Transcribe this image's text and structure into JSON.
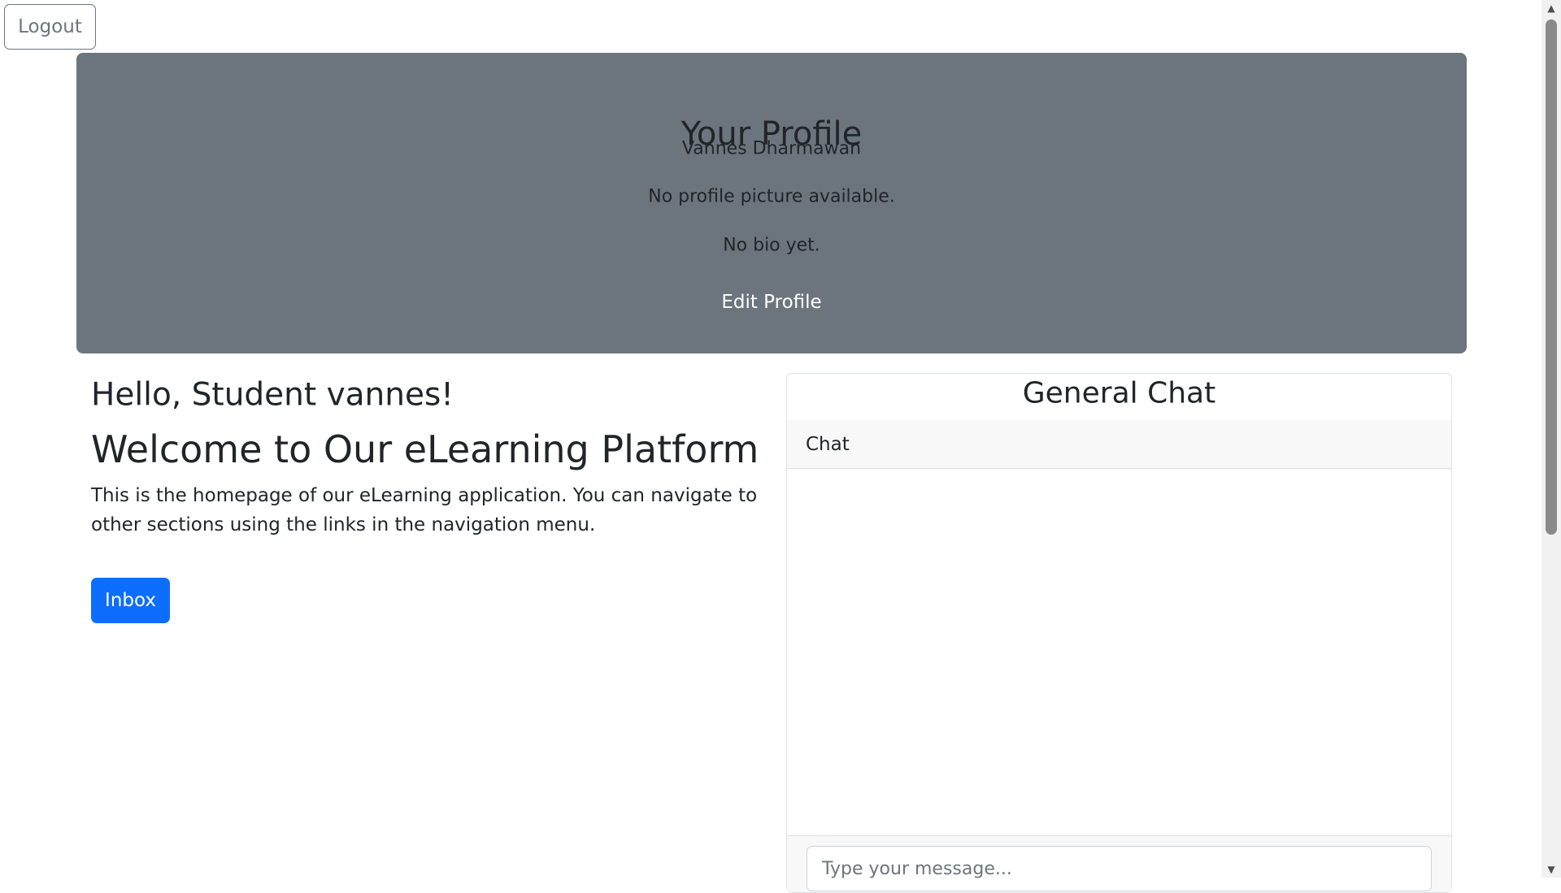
{
  "logout_label": "Logout",
  "profile": {
    "title": "Your Profile",
    "name": "Vannes Dharmawan",
    "picture_text": "No profile picture available.",
    "bio": "No bio yet.",
    "edit_label": "Edit Profile",
    "background_color": "#6c757d"
  },
  "main": {
    "greeting": "Hello, Student vannes!",
    "welcome_heading": "Welcome to Our eLearning Platform",
    "intro": "This is the homepage of our eLearning application. You can navigate to other sections using the links in the navigation menu.",
    "inbox_label": "Inbox",
    "accent_color": "#0d6efd"
  },
  "chat": {
    "title": "General Chat",
    "header": "Chat",
    "input_placeholder": "Type your message..."
  },
  "scrollbar": {
    "up_icon": "triangle-up-icon",
    "down_icon": "triangle-down-icon"
  }
}
